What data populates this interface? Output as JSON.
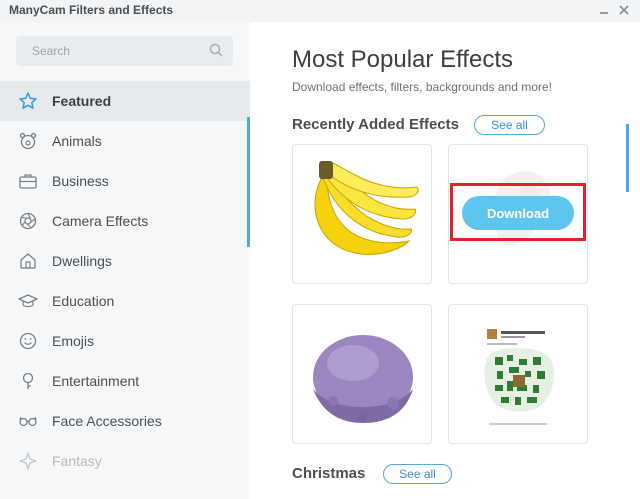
{
  "window": {
    "title": "ManyCam Filters and Effects"
  },
  "sidebar": {
    "search_placeholder": "Search",
    "items": [
      {
        "label": "Featured",
        "icon": "star-icon",
        "active": true
      },
      {
        "label": "Animals",
        "icon": "animal-icon"
      },
      {
        "label": "Business",
        "icon": "briefcase-icon"
      },
      {
        "label": "Camera Effects",
        "icon": "aperture-icon"
      },
      {
        "label": "Dwellings",
        "icon": "house-icon"
      },
      {
        "label": "Education",
        "icon": "graduation-cap-icon"
      },
      {
        "label": "Emojis",
        "icon": "smiley-icon"
      },
      {
        "label": "Entertainment",
        "icon": "lightbulb-icon"
      },
      {
        "label": "Face Accessories",
        "icon": "glasses-icon"
      },
      {
        "label": "Fantasy",
        "icon": "sparkle-icon"
      }
    ]
  },
  "main": {
    "title": "Most Popular Effects",
    "subtitle": "Download effects, filters, backgrounds and more!",
    "recently_added": {
      "title": "Recently Added Effects",
      "see_all": "See all"
    },
    "christmas": {
      "title": "Christmas",
      "see_all": "See all"
    },
    "cards": [
      {
        "image": "bananas"
      },
      {
        "image": "faded-effect",
        "button": "Download"
      },
      {
        "image": "ice-cream-scoop"
      },
      {
        "image": "qr-code-screenshot"
      }
    ]
  },
  "colors": {
    "accent": "#4fa8e0",
    "download": "#5ec6ee",
    "highlight": "#e2212b"
  }
}
